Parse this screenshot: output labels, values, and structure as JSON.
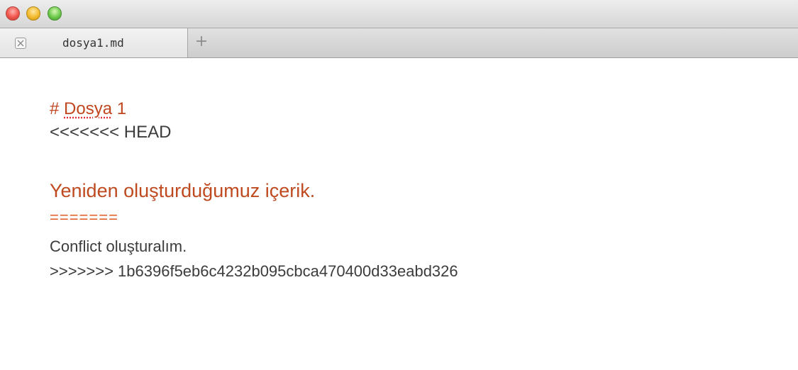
{
  "window": {
    "buttons": [
      "close-icon",
      "minimize-icon",
      "zoom-icon"
    ]
  },
  "tabs": [
    {
      "label": "dosya1.md",
      "close_icon": "close-icon"
    }
  ],
  "new_tab_label": "+",
  "editor": {
    "lines": {
      "heading_prefix": "# ",
      "heading_word": "Dosya",
      "heading_suffix": " 1",
      "head_marker": "<<<<<<< HEAD",
      "content_heading": "Yeniden oluşturduğumuz içerik.",
      "separator": "=======",
      "conflict_text": "Conflict oluşturalım.",
      "commit_marker": ">>>>>>> 1b6396f5eb6c4232b095cbca470400d33eabd326"
    }
  },
  "colors": {
    "heading": "#c0461e",
    "separator": "#e0622c",
    "text": "#3c3c3c"
  }
}
